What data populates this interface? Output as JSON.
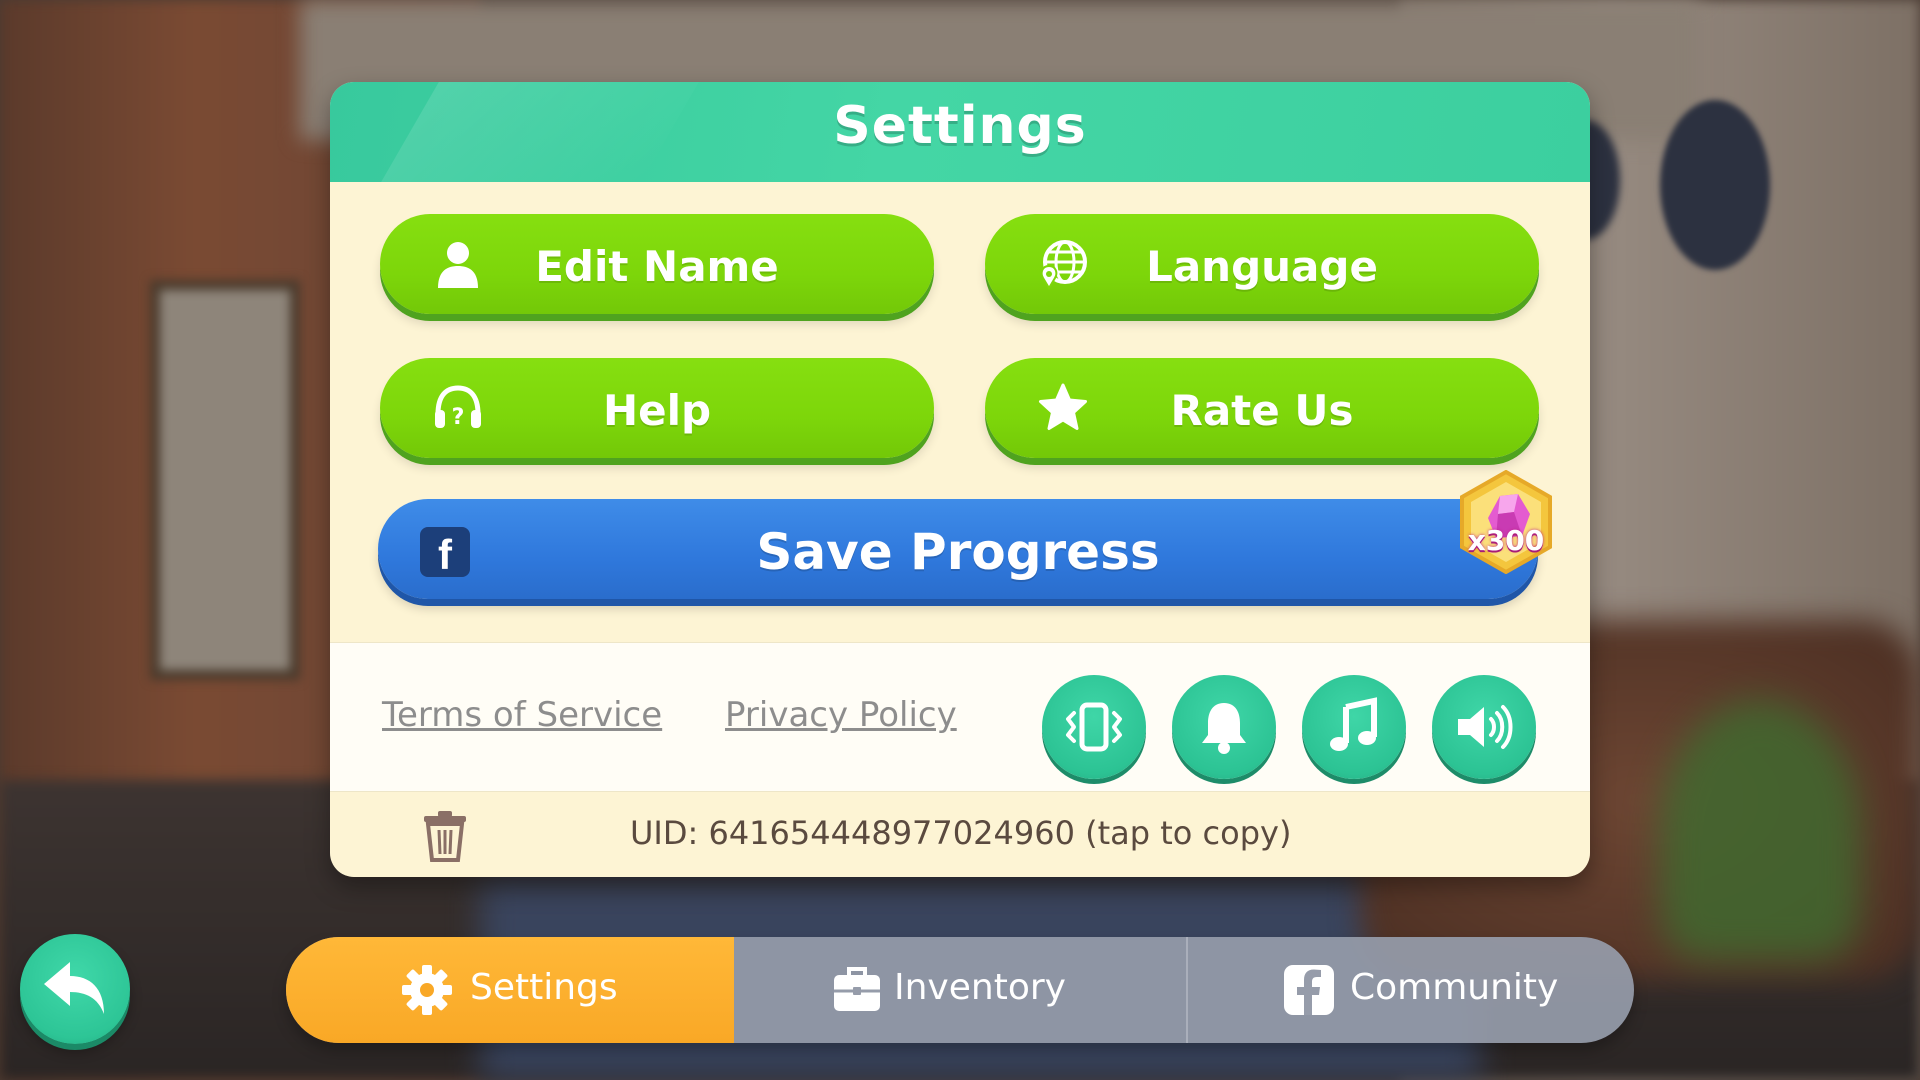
{
  "header": {
    "title": "Settings"
  },
  "buttons": {
    "edit_name": "Edit Name",
    "language": "Language",
    "help": "Help",
    "rate_us": "Rate Us",
    "save_progress": "Save Progress"
  },
  "save_reward": {
    "amount_label": "x300"
  },
  "links": {
    "terms": "Terms of Service",
    "privacy": "Privacy Policy"
  },
  "toggles": [
    {
      "icon": "vibration-icon",
      "state": "on"
    },
    {
      "icon": "bell-icon",
      "state": "on"
    },
    {
      "icon": "music-note-icon",
      "state": "on"
    },
    {
      "icon": "speaker-icon",
      "state": "on"
    }
  ],
  "uid": {
    "text": "UID: 641654448977024960 (tap to copy)"
  },
  "tabs": {
    "settings": "Settings",
    "inventory": "Inventory",
    "community": "Community",
    "active": "settings"
  },
  "colors": {
    "header": "#3ccf9f",
    "green_button": "#7dd60a",
    "blue_button": "#2f78dc",
    "active_tab": "#f9a826",
    "panel_bg": "#fdf4d4"
  }
}
